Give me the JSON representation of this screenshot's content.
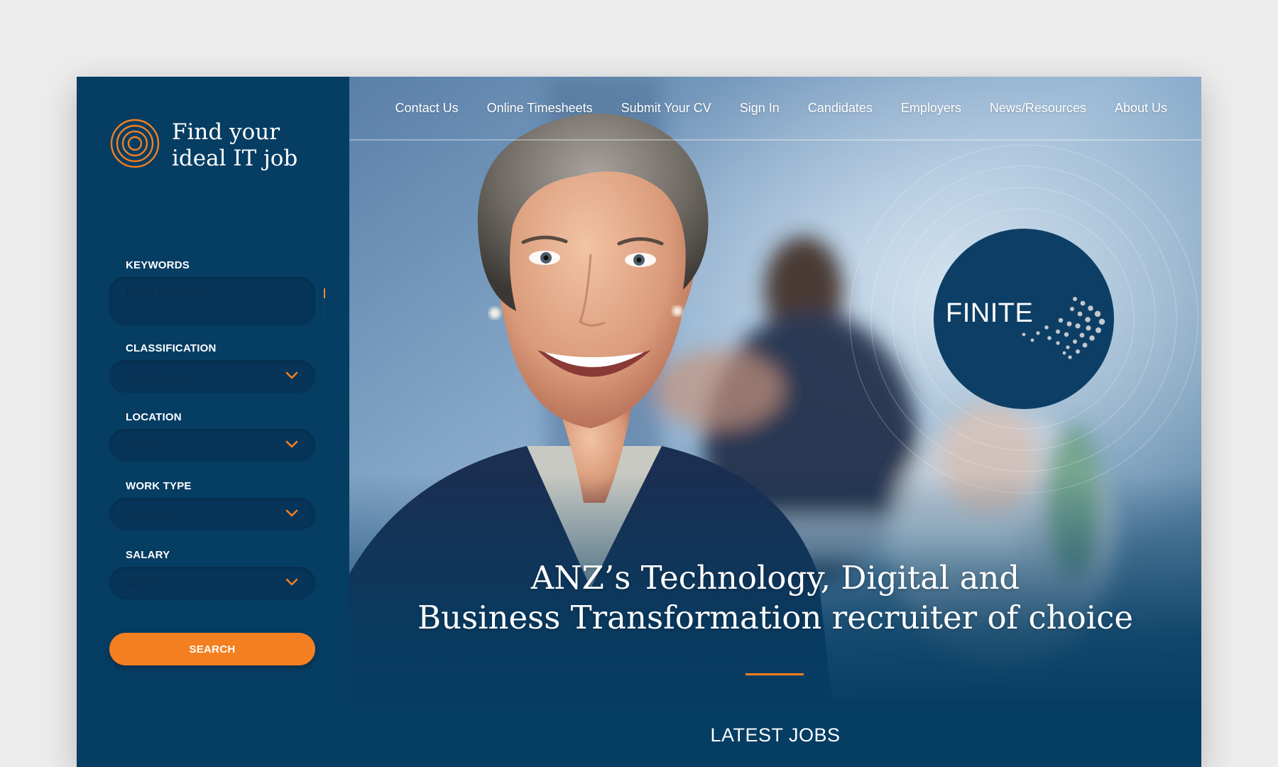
{
  "sidebar": {
    "brand": {
      "line1": "Find your",
      "line2": "ideal IT job",
      "logo_icon": "concentric-circles-icon",
      "accent_color": "#f47f20"
    },
    "keywords": {
      "label": "KEYWORDS",
      "placeholder": "Enter keywords",
      "value": ""
    },
    "classification": {
      "label": "CLASSIFICATION",
      "value": "Engineering",
      "icon": "chevron-down-icon"
    },
    "location": {
      "label": "LOCATION",
      "value": "Sydney",
      "icon": "chevron-down-icon"
    },
    "work_type": {
      "label": "WORK TYPE",
      "value": "Permanent",
      "icon": "chevron-down-icon"
    },
    "salary": {
      "label": "SALARY",
      "value": "$80,000",
      "icon": "chevron-down-icon"
    },
    "search_label": "SEARCH",
    "search_color": "#f47f20"
  },
  "nav": {
    "items": [
      {
        "label": "Contact Us"
      },
      {
        "label": "Online Timesheets"
      },
      {
        "label": "Submit Your CV"
      },
      {
        "label": "Sign In"
      },
      {
        "label": "Candidates"
      },
      {
        "label": "Employers"
      },
      {
        "label": "News/Resources"
      },
      {
        "label": "About Us"
      }
    ]
  },
  "hero": {
    "badge_text": "FINITE",
    "headline_line1": "ANZ’s Technology, Digital and",
    "headline_line2": "Business Transformation recruiter of choice",
    "latest_jobs": "LATEST JOBS"
  },
  "colors": {
    "primary_navy": "#063d63",
    "accent_orange": "#f47f20",
    "page_background": "#ececec"
  }
}
